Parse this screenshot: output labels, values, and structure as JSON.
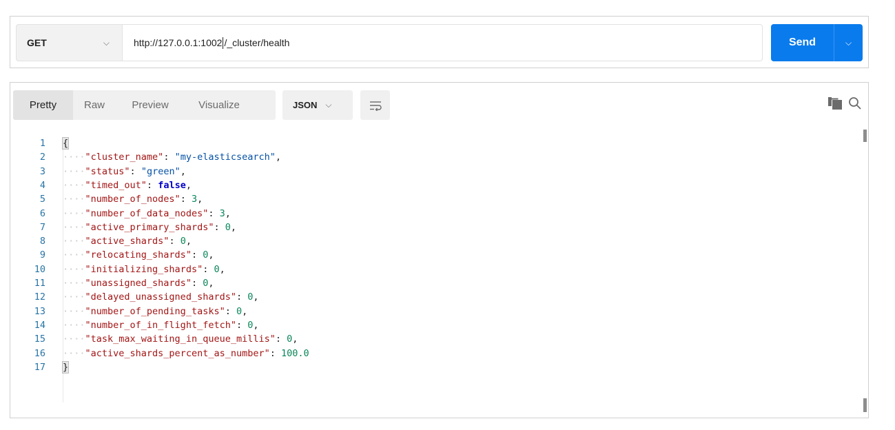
{
  "request": {
    "method": "GET",
    "url_before_caret": "http://127.0.0.1:1002",
    "url_after_caret": "/_cluster/health",
    "send_label": "Send"
  },
  "response": {
    "view_tabs": [
      "Pretty",
      "Raw",
      "Preview",
      "Visualize"
    ],
    "active_tab": "Pretty",
    "format": "JSON",
    "lines": [
      {
        "n": "1",
        "tokens": [
          {
            "t": "{",
            "c": "brace"
          }
        ]
      },
      {
        "n": "2",
        "tokens": [
          {
            "t": "\"cluster_name\"",
            "c": "k"
          },
          {
            "t": ": ",
            "c": "p"
          },
          {
            "t": "\"my-elasticsearch\"",
            "c": "s"
          },
          {
            "t": ",",
            "c": "p"
          }
        ]
      },
      {
        "n": "3",
        "tokens": [
          {
            "t": "\"status\"",
            "c": "k"
          },
          {
            "t": ": ",
            "c": "p"
          },
          {
            "t": "\"green\"",
            "c": "s"
          },
          {
            "t": ",",
            "c": "p"
          }
        ]
      },
      {
        "n": "4",
        "tokens": [
          {
            "t": "\"timed_out\"",
            "c": "k"
          },
          {
            "t": ": ",
            "c": "p"
          },
          {
            "t": "false",
            "c": "b"
          },
          {
            "t": ",",
            "c": "p"
          }
        ]
      },
      {
        "n": "5",
        "tokens": [
          {
            "t": "\"number_of_nodes\"",
            "c": "k"
          },
          {
            "t": ": ",
            "c": "p"
          },
          {
            "t": "3",
            "c": "n"
          },
          {
            "t": ",",
            "c": "p"
          }
        ]
      },
      {
        "n": "6",
        "tokens": [
          {
            "t": "\"number_of_data_nodes\"",
            "c": "k"
          },
          {
            "t": ": ",
            "c": "p"
          },
          {
            "t": "3",
            "c": "n"
          },
          {
            "t": ",",
            "c": "p"
          }
        ]
      },
      {
        "n": "7",
        "tokens": [
          {
            "t": "\"active_primary_shards\"",
            "c": "k"
          },
          {
            "t": ": ",
            "c": "p"
          },
          {
            "t": "0",
            "c": "n"
          },
          {
            "t": ",",
            "c": "p"
          }
        ]
      },
      {
        "n": "8",
        "tokens": [
          {
            "t": "\"active_shards\"",
            "c": "k"
          },
          {
            "t": ": ",
            "c": "p"
          },
          {
            "t": "0",
            "c": "n"
          },
          {
            "t": ",",
            "c": "p"
          }
        ]
      },
      {
        "n": "9",
        "tokens": [
          {
            "t": "\"relocating_shards\"",
            "c": "k"
          },
          {
            "t": ": ",
            "c": "p"
          },
          {
            "t": "0",
            "c": "n"
          },
          {
            "t": ",",
            "c": "p"
          }
        ]
      },
      {
        "n": "10",
        "tokens": [
          {
            "t": "\"initializing_shards\"",
            "c": "k"
          },
          {
            "t": ": ",
            "c": "p"
          },
          {
            "t": "0",
            "c": "n"
          },
          {
            "t": ",",
            "c": "p"
          }
        ]
      },
      {
        "n": "11",
        "tokens": [
          {
            "t": "\"unassigned_shards\"",
            "c": "k"
          },
          {
            "t": ": ",
            "c": "p"
          },
          {
            "t": "0",
            "c": "n"
          },
          {
            "t": ",",
            "c": "p"
          }
        ]
      },
      {
        "n": "12",
        "tokens": [
          {
            "t": "\"delayed_unassigned_shards\"",
            "c": "k"
          },
          {
            "t": ": ",
            "c": "p"
          },
          {
            "t": "0",
            "c": "n"
          },
          {
            "t": ",",
            "c": "p"
          }
        ]
      },
      {
        "n": "13",
        "tokens": [
          {
            "t": "\"number_of_pending_tasks\"",
            "c": "k"
          },
          {
            "t": ": ",
            "c": "p"
          },
          {
            "t": "0",
            "c": "n"
          },
          {
            "t": ",",
            "c": "p"
          }
        ]
      },
      {
        "n": "14",
        "tokens": [
          {
            "t": "\"number_of_in_flight_fetch\"",
            "c": "k"
          },
          {
            "t": ": ",
            "c": "p"
          },
          {
            "t": "0",
            "c": "n"
          },
          {
            "t": ",",
            "c": "p"
          }
        ]
      },
      {
        "n": "15",
        "tokens": [
          {
            "t": "\"task_max_waiting_in_queue_millis\"",
            "c": "k"
          },
          {
            "t": ": ",
            "c": "p"
          },
          {
            "t": "0",
            "c": "n"
          },
          {
            "t": ",",
            "c": "p"
          }
        ]
      },
      {
        "n": "16",
        "tokens": [
          {
            "t": "\"active_shards_percent_as_number\"",
            "c": "k"
          },
          {
            "t": ": ",
            "c": "p"
          },
          {
            "t": "100.0",
            "c": "n"
          }
        ]
      },
      {
        "n": "17",
        "tokens": [
          {
            "t": "}",
            "c": "brace"
          }
        ]
      }
    ]
  },
  "icons": {
    "method_dropdown": "chevron-down-icon",
    "send_dropdown": "chevron-down-icon",
    "wrap": "wrap-lines-icon",
    "copy": "copy-icon",
    "search": "search-icon"
  },
  "colors": {
    "send_button": "#097bed",
    "json_key": "#a31515",
    "json_string": "#0451a5",
    "json_number": "#098658",
    "json_boolean": "#0000c8",
    "line_number": "#2874a6"
  }
}
